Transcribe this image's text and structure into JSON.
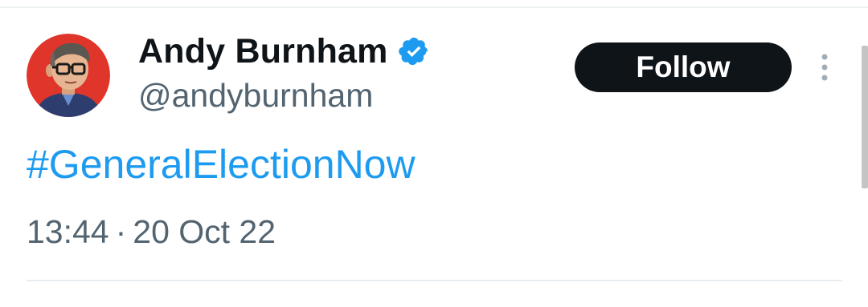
{
  "author": {
    "display_name": "Andy Burnham",
    "handle": "@andyburnham",
    "verified": true,
    "verified_icon": "verified-badge-icon",
    "avatar_bg_color": "#e0352b"
  },
  "actions": {
    "follow_label": "Follow",
    "more_icon": "vertical-ellipsis-icon"
  },
  "tweet": {
    "hashtag": "#GeneralElectionNow",
    "time": "13:44",
    "separator": "·",
    "date": "20 Oct 22"
  },
  "colors": {
    "text_primary": "#0f1419",
    "text_secondary": "#536471",
    "link": "#1d9bf0",
    "verified": "#1d9bf0",
    "button_bg": "#0f1419"
  }
}
